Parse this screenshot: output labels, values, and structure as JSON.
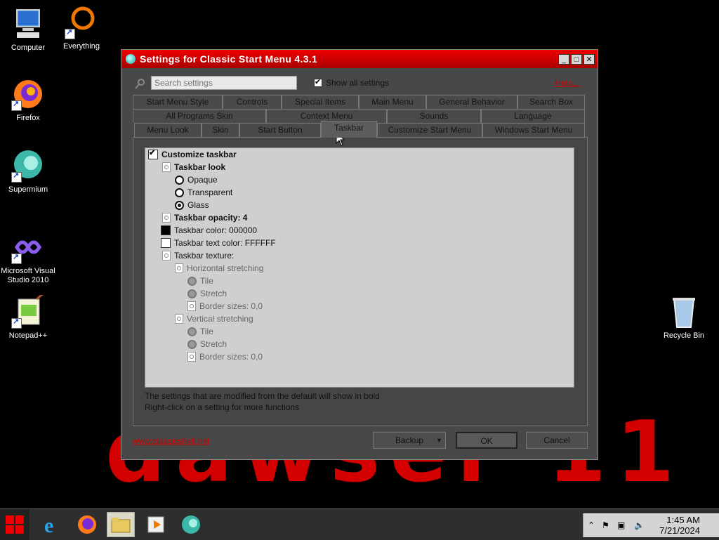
{
  "desktop": {
    "icons": [
      {
        "label": "Computer"
      },
      {
        "label": "Everything"
      },
      {
        "label": "Firefox"
      },
      {
        "label": "Supermium"
      },
      {
        "label": "Microsoft Visual Studio 2010"
      },
      {
        "label": "Notepad++"
      },
      {
        "label": "Recycle Bin"
      }
    ],
    "background_text": "dawser 11"
  },
  "window": {
    "title": "Settings for Classic Start Menu 4.3.1",
    "search_placeholder": "Search settings",
    "show_all_label": "Show all settings",
    "help_label": "Help...",
    "tabs_row1": [
      "Start Menu Style",
      "Controls",
      "Special Items",
      "Main Menu",
      "General Behavior",
      "Search Box"
    ],
    "tabs_row2": [
      "All Programs Skin",
      "Context Menu",
      "Sounds",
      "Language"
    ],
    "tabs_row3": [
      "Menu Look",
      "Skin",
      "Start Button",
      "Taskbar",
      "Customize Start Menu",
      "Windows Start Menu"
    ],
    "active_tab": "Taskbar",
    "settings": {
      "customize_taskbar": "Customize taskbar",
      "taskbar_look": "Taskbar look",
      "opaque": "Opaque",
      "transparent": "Transparent",
      "glass": "Glass",
      "opacity": "Taskbar opacity: 4",
      "color": "Taskbar color: 000000",
      "text_color": "Taskbar text color: FFFFFF",
      "texture": "Taskbar texture:",
      "h_stretch": "Horizontal stretching",
      "h_tile": "Tile",
      "h_stretch_opt": "Stretch",
      "h_border": "Border sizes: 0,0",
      "v_stretch": "Vertical stretching",
      "v_tile": "Tile",
      "v_stretch_opt": "Stretch",
      "v_border": "Border sizes: 0,0"
    },
    "note1": "The settings that are modified from the default will show in bold",
    "note2": "Right-click on a setting for more functions",
    "website": "www.classicshell.net",
    "backup_label": "Backup",
    "ok_label": "OK",
    "cancel_label": "Cancel"
  },
  "taskbar": {
    "time": "1:45 AM",
    "date": "7/21/2024"
  },
  "colors": {
    "title_red": "#cc0000",
    "accent_red": "#d40000",
    "swatch_black": "#000000",
    "swatch_white": "#FFFFFF"
  }
}
